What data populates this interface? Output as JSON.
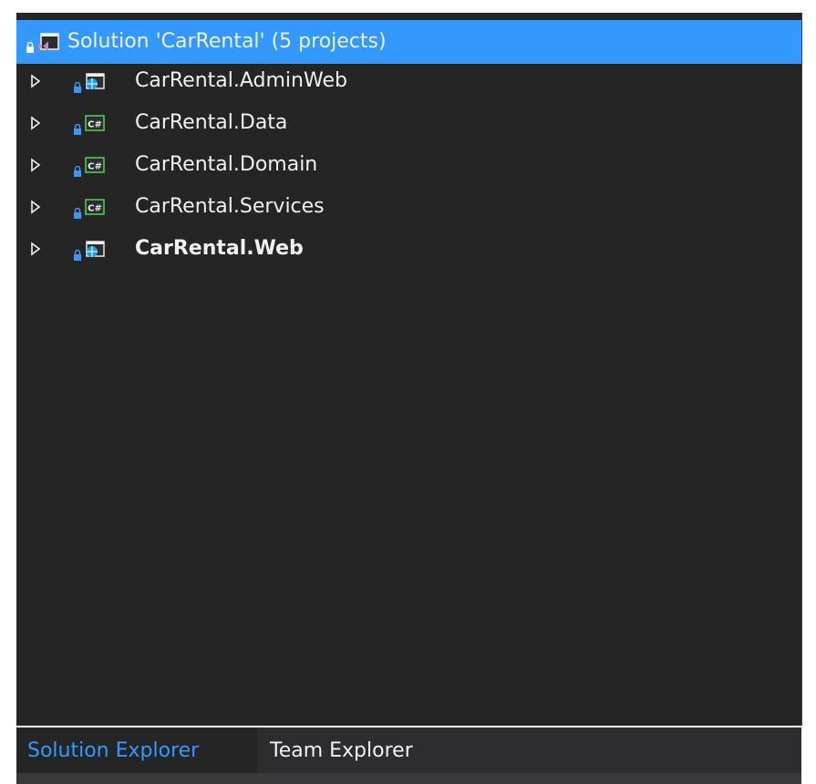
{
  "solution": {
    "title": "Solution 'CarRental' (5 projects)",
    "icon": "visual-studio-solution-icon",
    "selected": true
  },
  "projects": [
    {
      "label": "CarRental.AdminWeb",
      "icon": "web-project-icon",
      "bold": false
    },
    {
      "label": "CarRental.Data",
      "icon": "csharp-project-icon",
      "bold": false
    },
    {
      "label": "CarRental.Domain",
      "icon": "csharp-project-icon",
      "bold": false
    },
    {
      "label": "CarRental.Services",
      "icon": "csharp-project-icon",
      "bold": false
    },
    {
      "label": "CarRental.Web",
      "icon": "web-project-icon",
      "bold": true
    }
  ],
  "tabs": {
    "solution_explorer": "Solution Explorer",
    "team_explorer": "Team Explorer"
  },
  "colors": {
    "panel_bg": "#252526",
    "selection": "#3399ff",
    "text": "#f1f1f1",
    "lock": "#3399ff",
    "csharp_green": "#4ec94e",
    "web_blue": "#1ba1e2"
  }
}
